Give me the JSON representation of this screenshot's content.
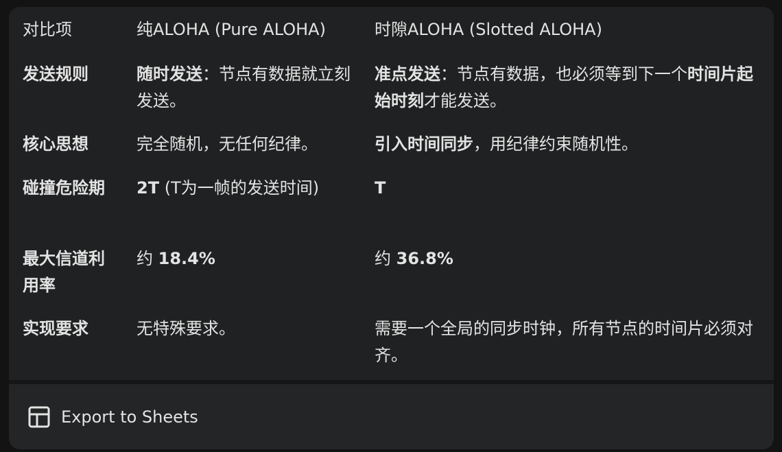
{
  "table": {
    "header": {
      "item": "对比项",
      "pure": "纯ALOHA (Pure ALOHA)",
      "slotted": "时隙ALOHA (Slotted ALOHA)"
    },
    "rows": [
      {
        "item": "发送规则",
        "pure": [
          {
            "text": "随时发送",
            "bold": true
          },
          {
            "text": "：节点有数据就立刻发送。",
            "bold": false
          }
        ],
        "slotted": [
          {
            "text": "准点发送",
            "bold": true
          },
          {
            "text": "：节点有数据，也必须等到下一个",
            "bold": false
          },
          {
            "text": "时间片起始时刻",
            "bold": true
          },
          {
            "text": "才能发送。",
            "bold": false
          }
        ]
      },
      {
        "item": "核心思想",
        "pure": [
          {
            "text": "完全随机，无任何纪律。",
            "bold": false
          }
        ],
        "slotted": [
          {
            "text": "引入时间同步",
            "bold": true
          },
          {
            "text": "，用纪律约束随机性。",
            "bold": false
          }
        ]
      },
      {
        "item": "碰撞危险期",
        "pure": [
          {
            "text": "2T",
            "bold": true
          },
          {
            "text": " (T为一帧的发送时间)",
            "bold": false
          }
        ],
        "slotted": [
          {
            "text": "T",
            "bold": true
          }
        ]
      },
      {
        "item": "最大信道利用率",
        "pure": [
          {
            "text": "约 ",
            "bold": false
          },
          {
            "text": "18.4%",
            "bold": true
          }
        ],
        "slotted": [
          {
            "text": "约 ",
            "bold": false
          },
          {
            "text": "36.8%",
            "bold": true
          }
        ]
      },
      {
        "item": "实现要求",
        "pure": [
          {
            "text": "无特殊要求。",
            "bold": false
          }
        ],
        "slotted": [
          {
            "text": "需要一个全局的同步时钟，所有节点的时间片必须对齐。",
            "bold": false
          }
        ]
      }
    ]
  },
  "footer": {
    "export_label": "Export to Sheets",
    "export_icon": "table-grid-icon"
  }
}
